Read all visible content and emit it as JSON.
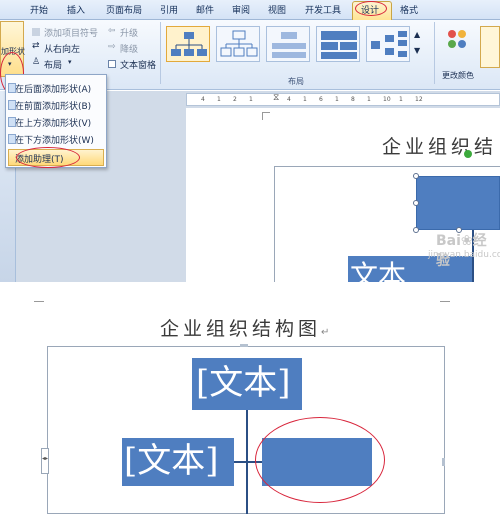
{
  "tabs": [
    "开始",
    "插入",
    "页面布局",
    "引用",
    "邮件",
    "审阅",
    "视图",
    "开发工具",
    "设计",
    "格式"
  ],
  "active_tab": "设计",
  "ribbon": {
    "add_shape_btn": "加形状",
    "add_bullet": "添加项目符号",
    "right_to_left": "从右向左",
    "layout_btn": "布局",
    "promote": "升级",
    "demote": "降级",
    "text_pane": "文本窗格",
    "group_layout_label": "布局",
    "change_colors": "更改颜色"
  },
  "menu": {
    "items": [
      "在后面添加形状(A)",
      "在前面添加形状(B)",
      "在上方添加形状(V)",
      "在下方添加形状(W)",
      "添加助理(T)"
    ],
    "highlighted_index": 4
  },
  "ruler_ticks": [
    "4",
    "1",
    "2",
    "1",
    "4",
    "1",
    "6",
    "1",
    "8",
    "1",
    "10",
    "1",
    "12"
  ],
  "doc_top": {
    "title": "企业组织结",
    "box_text": "文本",
    "watermark": "Bai❀经验",
    "watermark_sub": "jingyan.baidu.com"
  },
  "doc_bottom": {
    "title": "企业组织结构图",
    "para_mark": "↵",
    "top_box_text": "[文本]",
    "left_box_text": "[文本]"
  },
  "colors": {
    "accent_red": "#d8263c",
    "smartart_blue": "#4f7ec0",
    "ribbon_bg": "#dbe7f6",
    "selection_gold": "#ffd97a"
  }
}
